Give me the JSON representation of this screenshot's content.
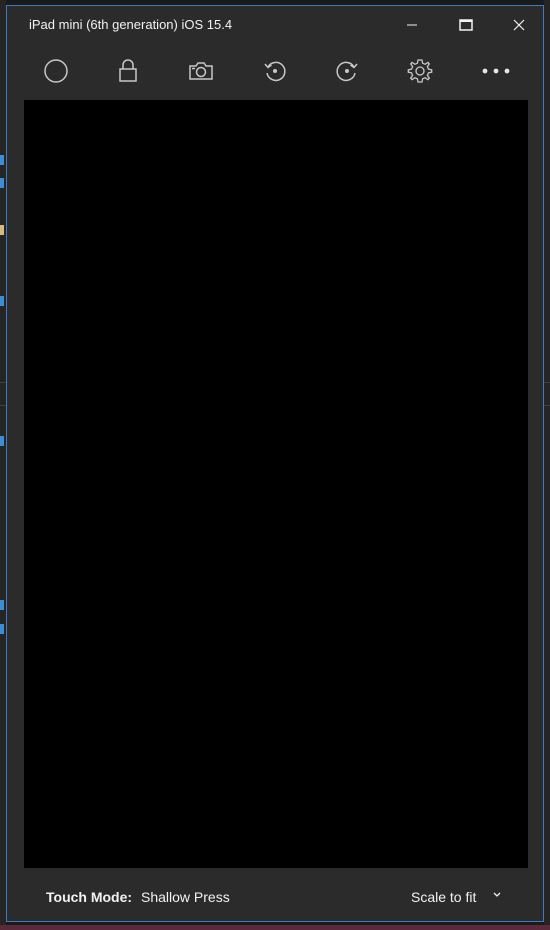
{
  "window": {
    "title": "iPad mini (6th generation) iOS 15.4",
    "accent_color": "#3b7bbf",
    "controls": {
      "minimize_icon": "minimize-icon",
      "maximize_icon": "maximize-icon",
      "close_icon": "close-icon"
    }
  },
  "toolbar": {
    "tools": [
      {
        "icon": "home-circle-icon"
      },
      {
        "icon": "lock-icon"
      },
      {
        "icon": "camera-icon"
      },
      {
        "icon": "rotate-left-icon"
      },
      {
        "icon": "rotate-right-icon"
      },
      {
        "icon": "gear-icon"
      },
      {
        "icon": "more-icon"
      }
    ]
  },
  "screen": {
    "background": "#000000"
  },
  "status": {
    "touch_mode_label": "Touch Mode:",
    "touch_mode_value": "Shallow Press",
    "scale_value": "Scale to fit"
  }
}
